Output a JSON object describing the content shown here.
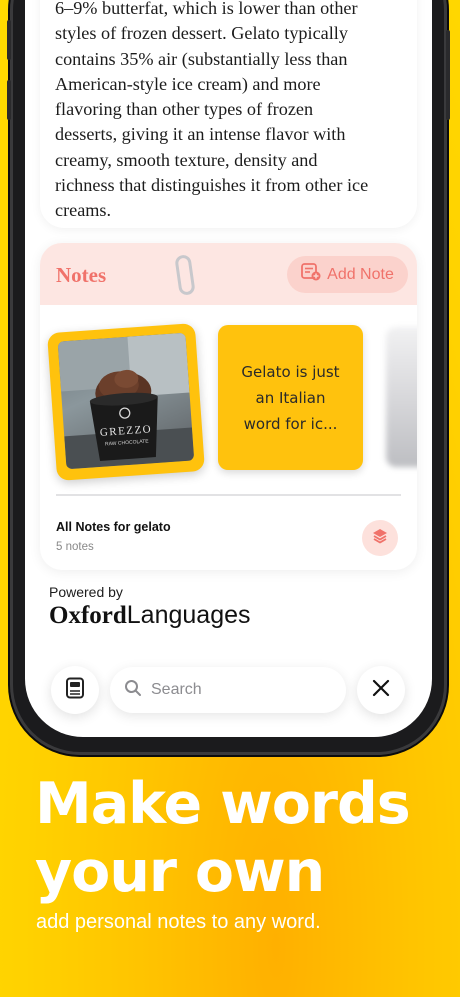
{
  "definition": {
    "lines": [
      "6–9% butterfat, which is lower than other",
      "styles of frozen dessert. Gelato typically",
      "contains 35% air (substantially less than",
      "American-style ice cream) and more",
      "flavoring than other types of frozen",
      "desserts, giving it an intense flavor with",
      "creamy, smooth texture, density and",
      "richness that distinguishes it from other ice",
      "creams."
    ]
  },
  "notes": {
    "title": "Notes",
    "add_label": "Add Note",
    "photo_brand": "GREZZO",
    "photo_brand_sub": "RAW CHOCOLATE",
    "text_note": "Gelato is just an Italian word for ic...",
    "all_notes_title": "All Notes for gelato",
    "all_notes_count": "5 notes"
  },
  "attribution": {
    "powered_by": "Powered by",
    "brand_bold": "Oxford",
    "brand_light": "Languages"
  },
  "bottom_bar": {
    "search_placeholder": "Search"
  },
  "promo": {
    "headline_line1": "Make words",
    "headline_line2": "your own",
    "subtitle": "add personal notes to any word."
  },
  "colors": {
    "accent": "#f0726a",
    "note_yellow": "#ffc20d",
    "background": "#ffcc00"
  }
}
